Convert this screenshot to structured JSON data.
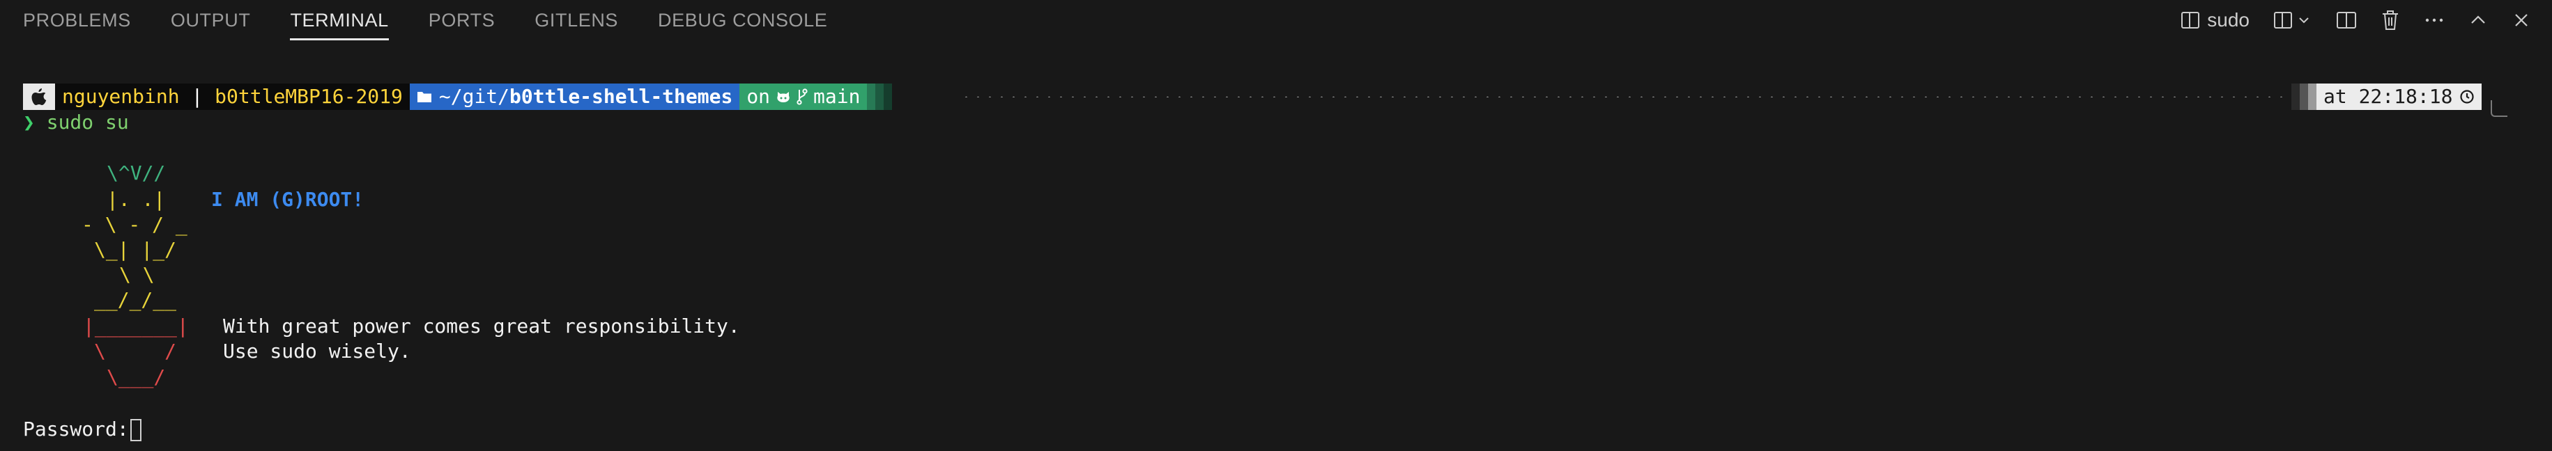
{
  "panel_tabs": [
    "PROBLEMS",
    "OUTPUT",
    "TERMINAL",
    "PORTS",
    "GITLENS",
    "DEBUG CONSOLE"
  ],
  "active_tab": "TERMINAL",
  "toolbar": {
    "terminal_name": "sudo",
    "icons": [
      "terminal-icon",
      "split-dropdown-icon",
      "split-editor-icon",
      "trash-icon",
      "more-icon",
      "maximize-icon",
      "close-icon"
    ]
  },
  "prompt": {
    "os_icon": "",
    "user": "nguyenbinh",
    "separator": "|",
    "host": "b0ttleMBP16-2019",
    "dir_prefix": "~/git/",
    "dir_bold": "b0ttle-shell-themes",
    "git_on": "on",
    "branch": "main",
    "time_label": "at 22:18:18"
  },
  "command": {
    "caret": "❯",
    "text": "sudo su"
  },
  "ascii_art": {
    "line1": "\\^V//",
    "line2": "|. .|",
    "line3": "- \\ - / _",
    "line4": "\\_| |_/",
    "line5": "\\ \\",
    "line6": "__/_/__",
    "line7": "|_______|",
    "line8": "\\     /",
    "line9": "\\___/"
  },
  "messages": {
    "root": "I AM (G)ROOT!",
    "power": "With great power comes great responsibility.",
    "wisely": "Use sudo wisely."
  },
  "password_prompt": "Password:"
}
